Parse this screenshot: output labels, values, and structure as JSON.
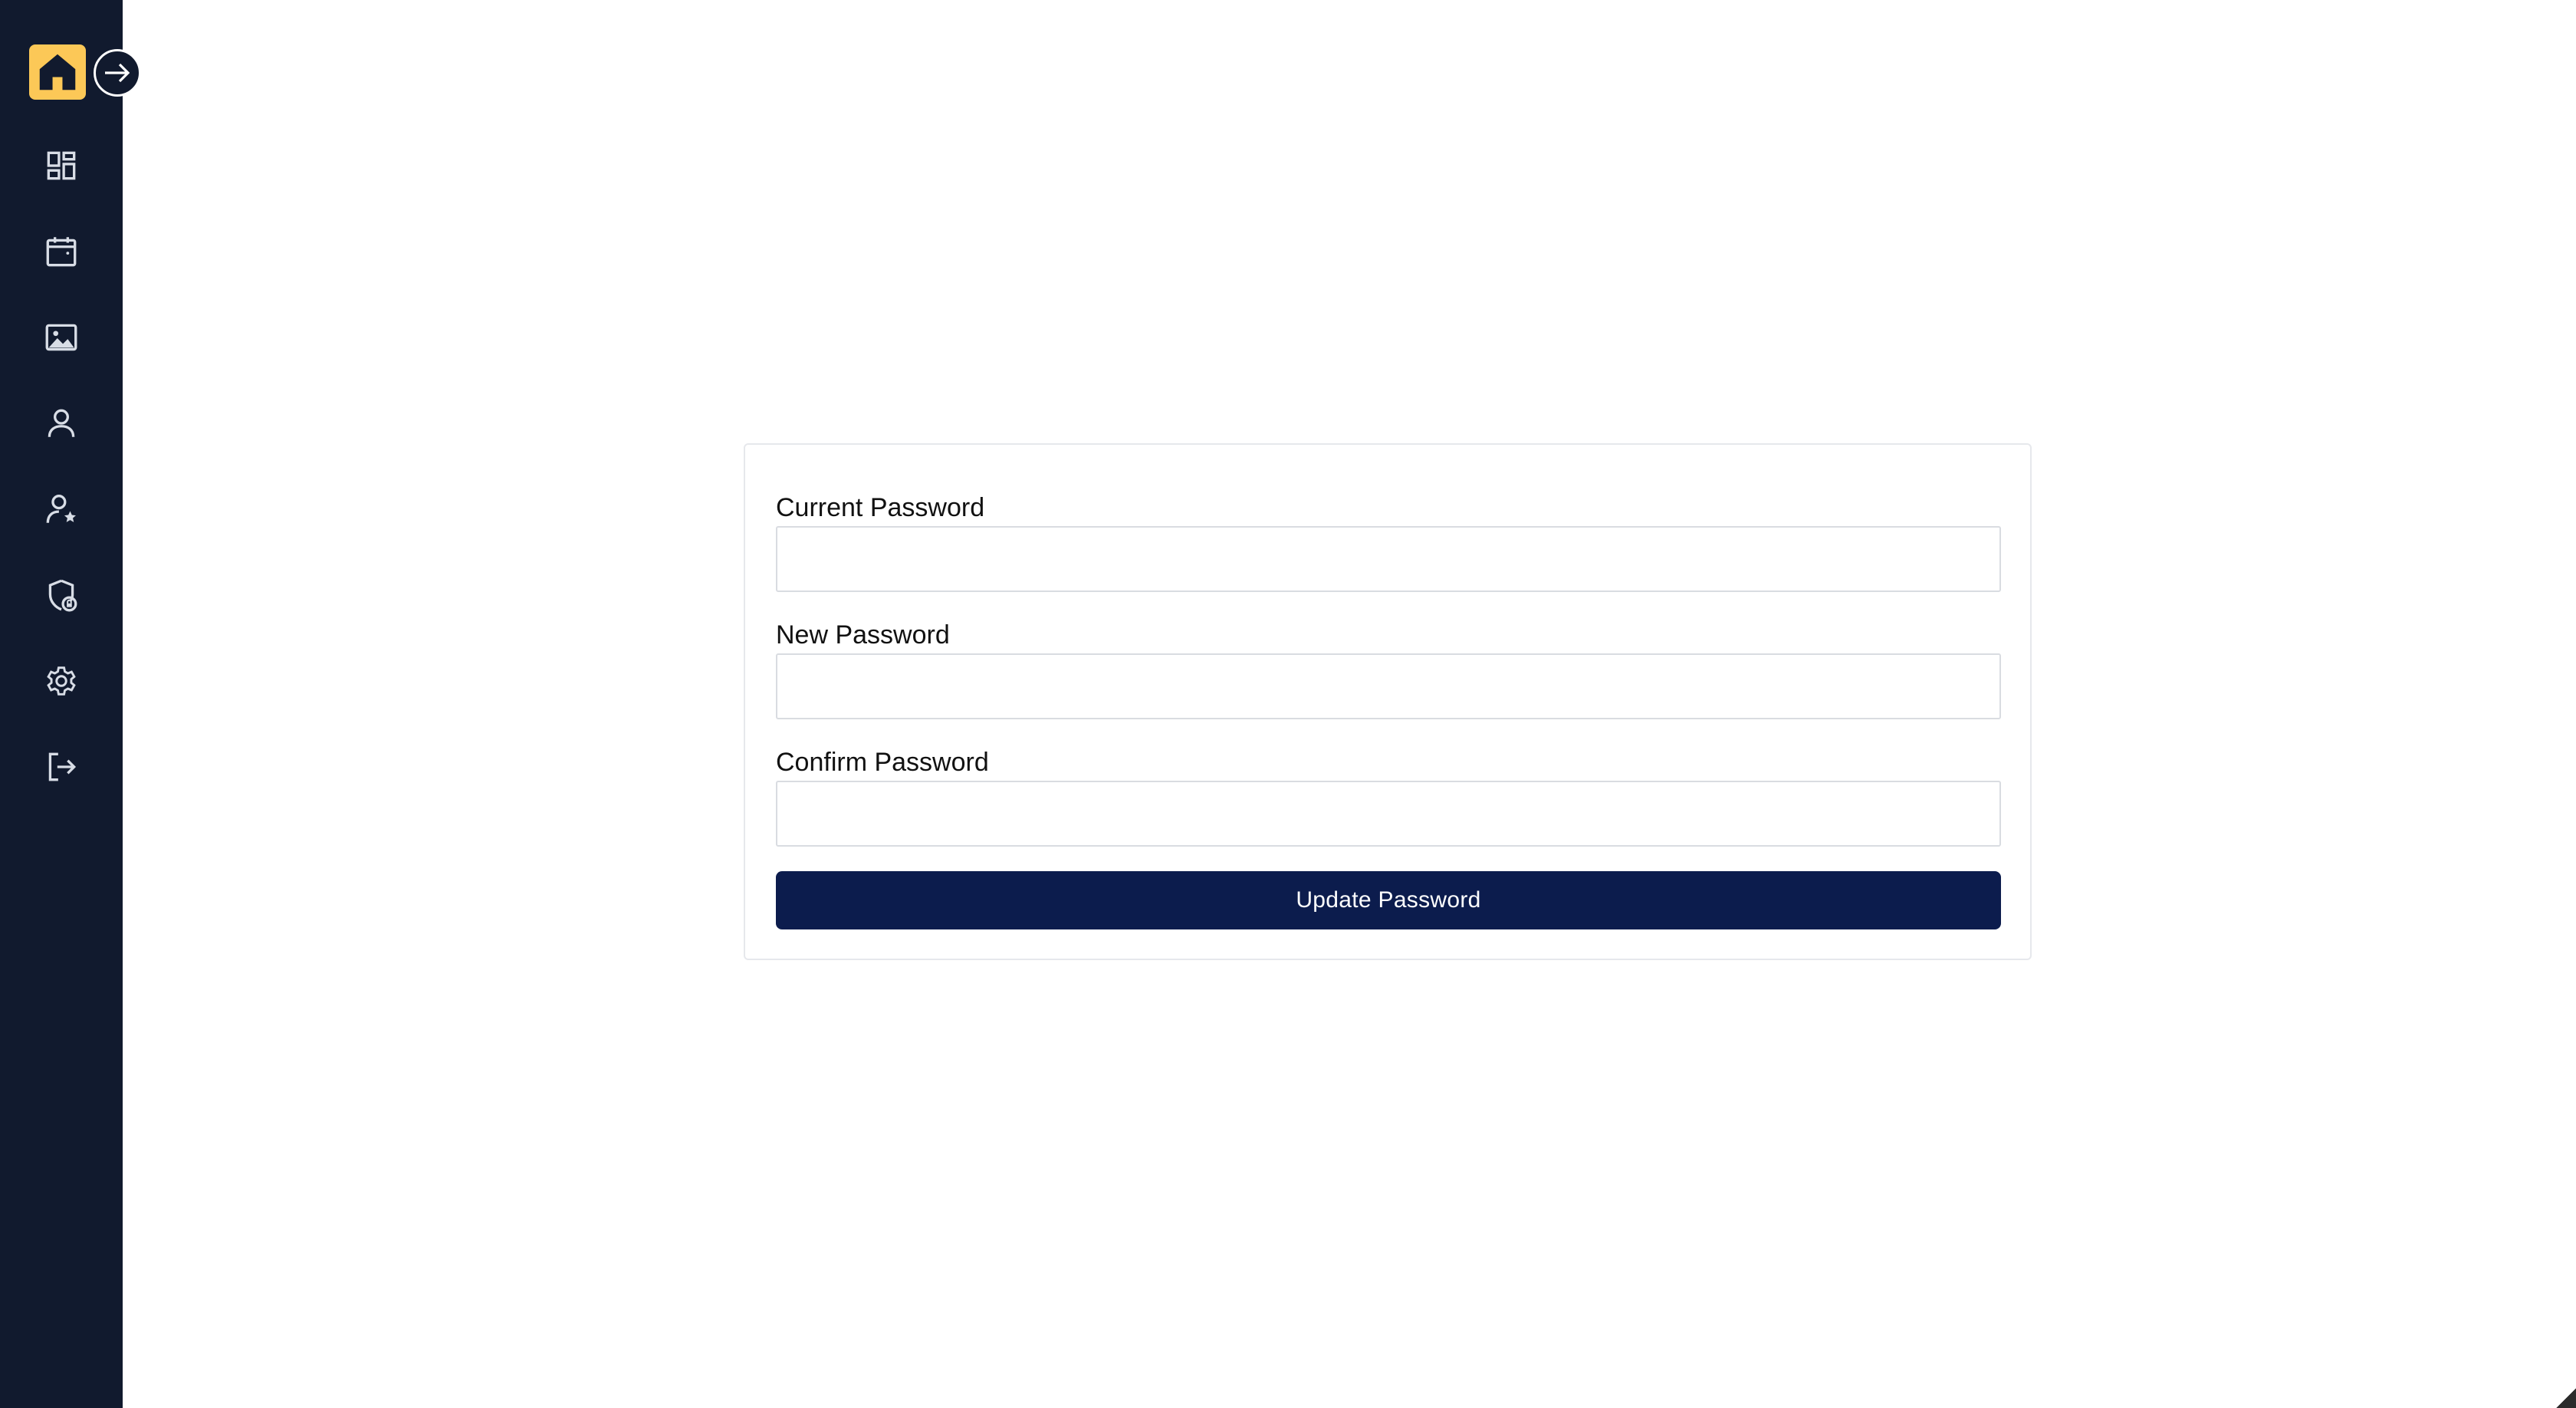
{
  "sidebar": {
    "logo_icon": "home-icon",
    "expand_icon": "arrow-right-circle-icon",
    "items": [
      {
        "icon": "dashboard-icon"
      },
      {
        "icon": "calendar-icon"
      },
      {
        "icon": "image-icon"
      },
      {
        "icon": "user-icon"
      },
      {
        "icon": "user-star-icon"
      },
      {
        "icon": "shield-lock-icon"
      },
      {
        "icon": "gear-icon"
      },
      {
        "icon": "logout-icon"
      }
    ]
  },
  "form": {
    "current_password": {
      "label": "Current Password",
      "value": "",
      "placeholder": ""
    },
    "new_password": {
      "label": "New Password",
      "value": "",
      "placeholder": ""
    },
    "confirm_password": {
      "label": "Confirm Password",
      "value": "",
      "placeholder": ""
    },
    "submit_label": "Update Password"
  },
  "colors": {
    "sidebar_bg": "#111a2e",
    "logo_accent": "#fcc857",
    "button_bg": "#0c1c4d",
    "icon_color": "#d8dde6"
  }
}
